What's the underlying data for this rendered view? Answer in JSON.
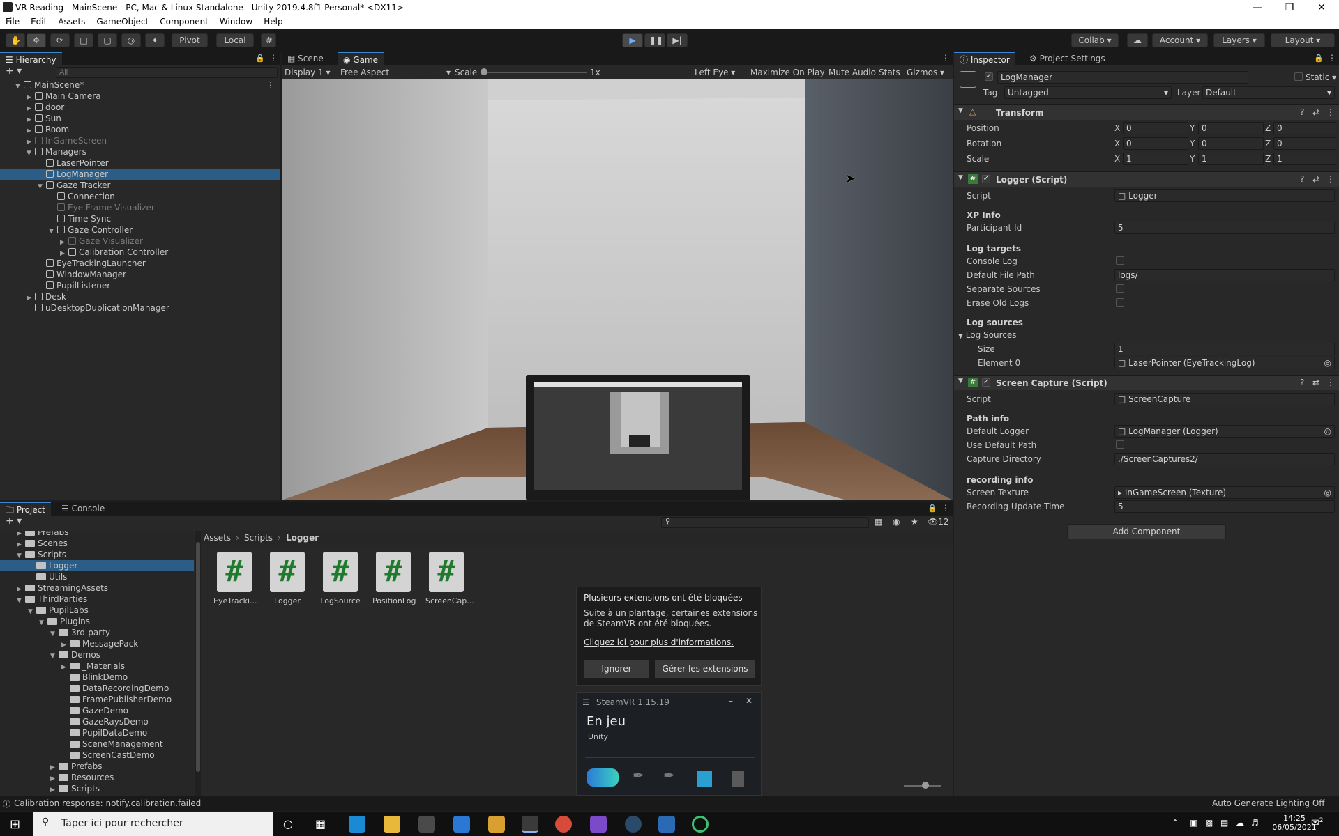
{
  "window": {
    "title": "VR Reading - MainScene - PC, Mac & Linux Standalone - Unity 2019.4.8f1 Personal* <DX11>"
  },
  "menu": [
    "File",
    "Edit",
    "Assets",
    "GameObject",
    "Component",
    "Window",
    "Help"
  ],
  "toolbar": {
    "pivot": "Pivot",
    "local": "Local",
    "collab": "Collab",
    "account": "Account",
    "layers": "Layers",
    "layout": "Layout"
  },
  "hierarchy": {
    "tab": "Hierarchy",
    "search_placeholder": "All",
    "items": [
      {
        "label": "MainScene*",
        "depth": 0,
        "arrow": "open",
        "icon": "scene",
        "selected": false,
        "dim": false
      },
      {
        "label": "Main Camera",
        "depth": 1,
        "arrow": "closed",
        "dim": false
      },
      {
        "label": "door",
        "depth": 1,
        "arrow": "closed",
        "dim": false
      },
      {
        "label": "Sun",
        "depth": 1,
        "arrow": "closed",
        "dim": false
      },
      {
        "label": "Room",
        "depth": 1,
        "arrow": "closed",
        "dim": false
      },
      {
        "label": "InGameScreen",
        "depth": 1,
        "arrow": "closed",
        "dim": true
      },
      {
        "label": "Managers",
        "depth": 1,
        "arrow": "open",
        "dim": false
      },
      {
        "label": "LaserPointer",
        "depth": 2,
        "arrow": "none",
        "dim": false
      },
      {
        "label": "LogManager",
        "depth": 2,
        "arrow": "none",
        "dim": false,
        "selected": true
      },
      {
        "label": "Gaze Tracker",
        "depth": 2,
        "arrow": "open",
        "dim": false
      },
      {
        "label": "Connection",
        "depth": 3,
        "arrow": "none",
        "dim": false
      },
      {
        "label": "Eye Frame Visualizer",
        "depth": 3,
        "arrow": "none",
        "dim": true
      },
      {
        "label": "Time Sync",
        "depth": 3,
        "arrow": "none",
        "dim": false
      },
      {
        "label": "Gaze Controller",
        "depth": 3,
        "arrow": "open",
        "dim": false
      },
      {
        "label": "Gaze Visualizer",
        "depth": 4,
        "arrow": "closed",
        "dim": true
      },
      {
        "label": "Calibration Controller",
        "depth": 4,
        "arrow": "closed",
        "dim": false
      },
      {
        "label": "EyeTrackingLauncher",
        "depth": 2,
        "arrow": "none",
        "dim": false
      },
      {
        "label": "WindowManager",
        "depth": 2,
        "arrow": "none",
        "dim": false
      },
      {
        "label": "PupilListener",
        "depth": 2,
        "arrow": "none",
        "dim": false
      },
      {
        "label": "Desk",
        "depth": 1,
        "arrow": "closed",
        "dim": false
      },
      {
        "label": "uDesktopDuplicationManager",
        "depth": 1,
        "arrow": "none",
        "dim": false
      }
    ]
  },
  "game": {
    "tabs": [
      "Scene",
      "Game"
    ],
    "display": "Display 1",
    "aspect": "Free Aspect",
    "scale_label": "Scale",
    "scale_value": "1x",
    "eye": "Left Eye",
    "maximize": "Maximize On Play",
    "mute": "Mute Audio",
    "stats": "Stats",
    "gizmos": "Gizmos"
  },
  "inspector": {
    "tabs": [
      "Inspector",
      "Project Settings"
    ],
    "object_name": "LogManager",
    "static": "Static",
    "tag_label": "Tag",
    "tag_value": "Untagged",
    "layer_label": "Layer",
    "layer_value": "Default",
    "transform": {
      "title": "Transform",
      "position_label": "Position",
      "rotation_label": "Rotation",
      "scale_label": "Scale",
      "position": [
        "0",
        "0",
        "0"
      ],
      "rotation": [
        "0",
        "0",
        "0"
      ],
      "scale": [
        "1",
        "1",
        "1"
      ]
    },
    "logger": {
      "title": "Logger (Script)",
      "script_label": "Script",
      "script_value": "Logger",
      "xp_info": "XP Info",
      "participant_label": "Participant Id",
      "participant_value": "5",
      "log_targets": "Log targets",
      "console_log": "Console Log",
      "default_file_path": "Default File Path",
      "default_file_path_value": "logs/",
      "separate_sources": "Separate Sources",
      "erase_old_logs": "Erase Old Logs",
      "log_sources_header": "Log sources",
      "log_sources": "Log Sources",
      "size_label": "Size",
      "size_value": "1",
      "element0_label": "Element 0",
      "element0_value": "LaserPointer (EyeTrackingLog)"
    },
    "screen_capture": {
      "title": "Screen Capture (Script)",
      "script_label": "Script",
      "script_value": "ScreenCapture",
      "path_info": "Path info",
      "default_logger": "Default Logger",
      "default_logger_value": "LogManager (Logger)",
      "use_default_path": "Use Default Path",
      "capture_directory": "Capture Directory",
      "capture_directory_value": "./ScreenCaptures2/",
      "recording_info": "recording info",
      "screen_texture": "Screen Texture",
      "screen_texture_value": "InGameScreen (Texture)",
      "recording_update_time": "Recording Update Time",
      "recording_update_time_value": "5"
    },
    "add_component": "Add Component"
  },
  "project": {
    "tabs": [
      "Project",
      "Console"
    ],
    "hidden_count": "12",
    "breadcrumb": [
      "Assets",
      "Scripts",
      "Logger"
    ],
    "tree": [
      {
        "label": "Prefabs",
        "depth": 1,
        "arrow": "closed"
      },
      {
        "label": "Scenes",
        "depth": 1,
        "arrow": "closed"
      },
      {
        "label": "Scripts",
        "depth": 1,
        "arrow": "open"
      },
      {
        "label": "Logger",
        "depth": 2,
        "arrow": "none",
        "selected": true
      },
      {
        "label": "Utils",
        "depth": 2,
        "arrow": "none"
      },
      {
        "label": "StreamingAssets",
        "depth": 1,
        "arrow": "closed"
      },
      {
        "label": "ThirdParties",
        "depth": 1,
        "arrow": "open"
      },
      {
        "label": "PupilLabs",
        "depth": 2,
        "arrow": "open"
      },
      {
        "label": "Plugins",
        "depth": 3,
        "arrow": "open"
      },
      {
        "label": "3rd-party",
        "depth": 4,
        "arrow": "open"
      },
      {
        "label": "MessagePack",
        "depth": 5,
        "arrow": "closed"
      },
      {
        "label": "Demos",
        "depth": 4,
        "arrow": "open"
      },
      {
        "label": "_Materials",
        "depth": 5,
        "arrow": "closed"
      },
      {
        "label": "BlinkDemo",
        "depth": 5,
        "arrow": "none"
      },
      {
        "label": "DataRecordingDemo",
        "depth": 5,
        "arrow": "none"
      },
      {
        "label": "FramePublisherDemo",
        "depth": 5,
        "arrow": "none"
      },
      {
        "label": "GazeDemo",
        "depth": 5,
        "arrow": "none"
      },
      {
        "label": "GazeRaysDemo",
        "depth": 5,
        "arrow": "none"
      },
      {
        "label": "PupilDataDemo",
        "depth": 5,
        "arrow": "none"
      },
      {
        "label": "SceneManagement",
        "depth": 5,
        "arrow": "none"
      },
      {
        "label": "ScreenCastDemo",
        "depth": 5,
        "arrow": "none"
      },
      {
        "label": "Prefabs",
        "depth": 4,
        "arrow": "closed"
      },
      {
        "label": "Resources",
        "depth": 4,
        "arrow": "closed"
      },
      {
        "label": "Scripts",
        "depth": 4,
        "arrow": "closed"
      }
    ],
    "assets": [
      "EyeTracki...",
      "Logger",
      "LogSource",
      "PositionLog",
      "ScreenCap..."
    ]
  },
  "notification": {
    "title": "Plusieurs extensions ont été bloquées",
    "body": "Suite à un plantage, certaines extensions de SteamVR ont été bloquées.",
    "link": "Cliquez ici pour plus d'informations.",
    "ignore": "Ignorer",
    "manage": "Gérer les extensions"
  },
  "steamvr": {
    "title": "SteamVR 1.15.19",
    "status": "En jeu",
    "app": "Unity"
  },
  "statusbar": {
    "message": "Calibration response: notify.calibration.failed",
    "right": "Auto Generate Lighting Off"
  },
  "taskbar": {
    "search_placeholder": "Taper ici pour rechercher",
    "time": "14:25",
    "date": "06/05/2021",
    "notif_count": "2"
  },
  "colors": {
    "accent": "#3c87d4",
    "selection": "#2c5d87",
    "script_hash": "#1f7a2e"
  }
}
